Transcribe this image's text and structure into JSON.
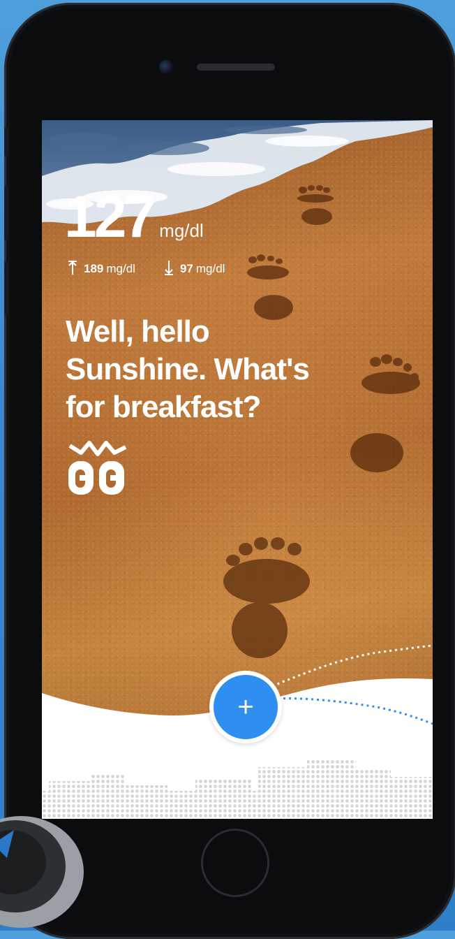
{
  "glucose": {
    "value": "127",
    "unit": "mg/dl",
    "high": {
      "value": "189",
      "unit": "mg/dl"
    },
    "low": {
      "value": "97",
      "unit": "mg/dl"
    }
  },
  "greeting": {
    "line1": "Well, hello",
    "line2": "Sunshine. What's",
    "line3": "for breakfast?"
  },
  "actions": {
    "add_label": "+"
  },
  "icons": {
    "high": "arrow-up-icon",
    "low": "arrow-down-icon",
    "logo": "app-logo-icon",
    "add": "plus-icon"
  },
  "colors": {
    "accent": "#2f8ff0",
    "background": "#3a8bd0",
    "text": "#ffffff"
  }
}
